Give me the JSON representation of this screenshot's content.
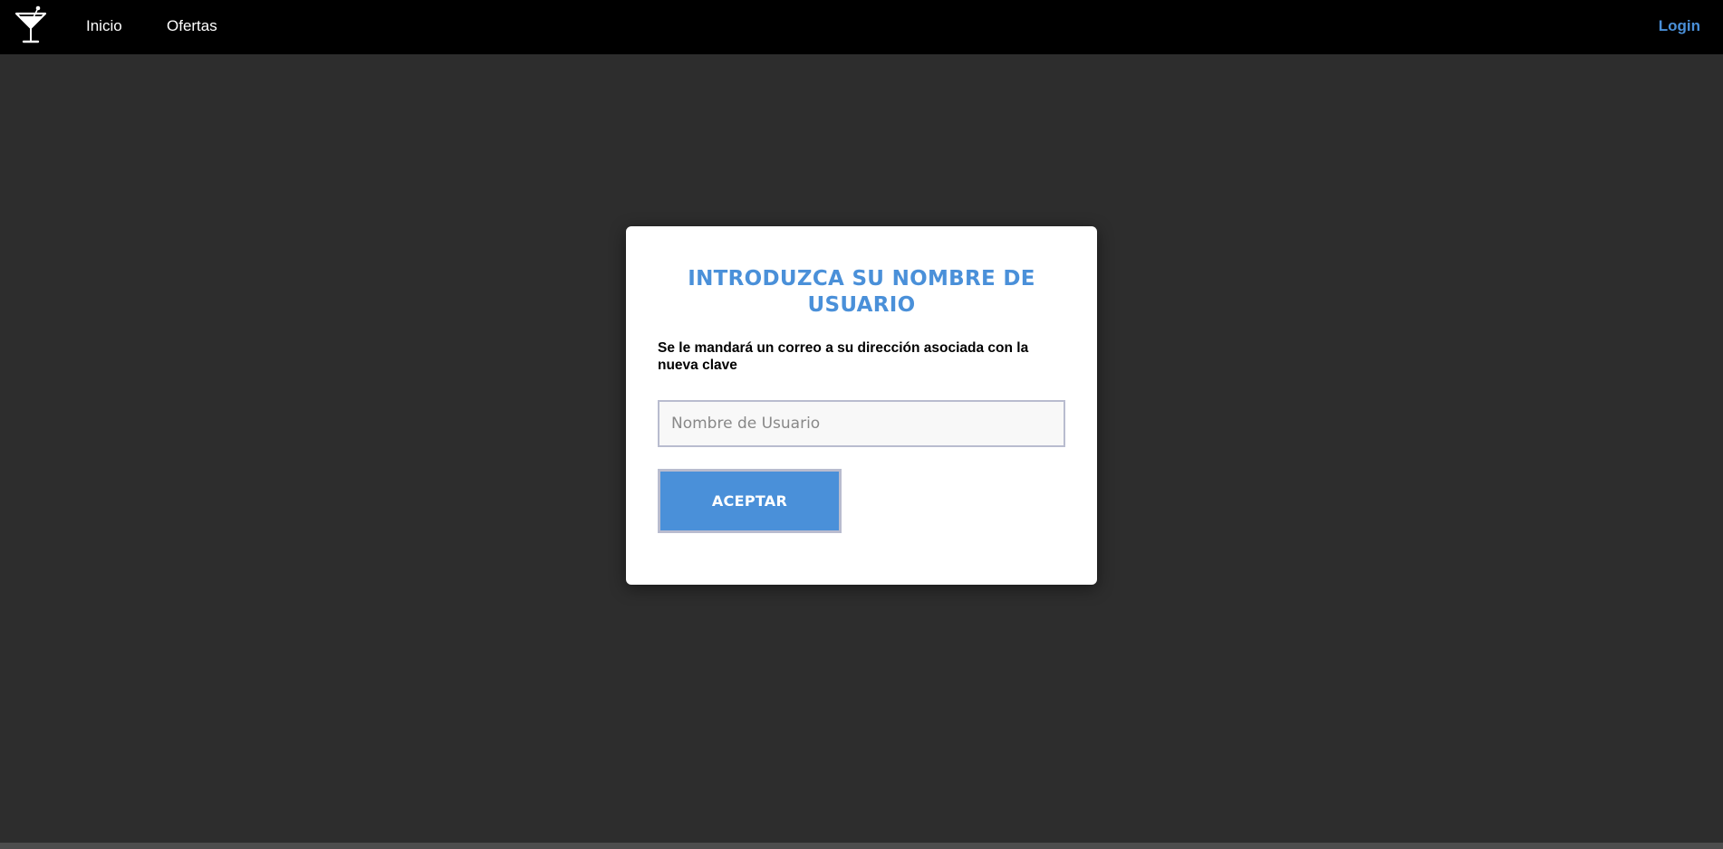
{
  "nav": {
    "logo_icon": "martini-glass-icon",
    "links": [
      {
        "label": "Inicio"
      },
      {
        "label": "Ofertas"
      }
    ],
    "login_label": "Login"
  },
  "colors": {
    "accent": "#4a90d9",
    "navbar_bg": "#000000",
    "page_bg": "#2d2d2d",
    "card_bg": "#ffffff"
  },
  "card": {
    "title": "INTRODUZCA SU NOMBRE DE USUARIO",
    "description": "Se le mandará un correo a su dirección asociada con la nueva clave",
    "input": {
      "value": "",
      "placeholder": "Nombre de Usuario"
    },
    "button_label": "ACEPTAR"
  }
}
